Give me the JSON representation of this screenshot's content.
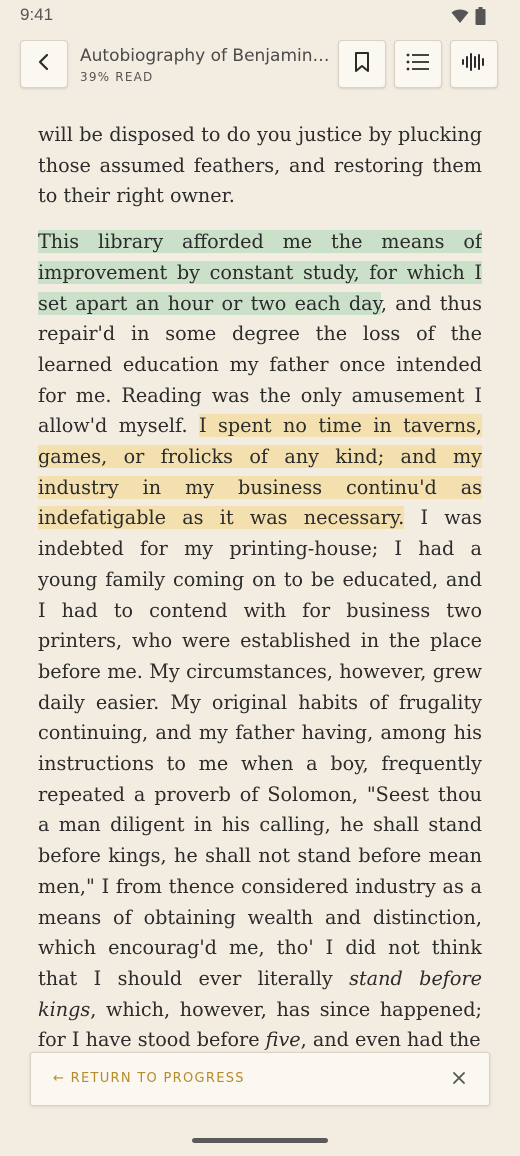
{
  "status_bar": {
    "time": "9:41",
    "icons": [
      "wifi-icon",
      "battery-icon"
    ]
  },
  "toolbar": {
    "title": "Autobiography of Benjamin Franklin",
    "progress_label": "39% READ",
    "progress": 0.39,
    "icons": {
      "back": "chevron-left-icon",
      "bookmark": "bookmark-icon",
      "contents": "list-icon",
      "audio": "audio-waveform-icon"
    }
  },
  "reader": {
    "p1": "will be disposed to do you justice by plucking those assumed feathers, and restoring them to their right owner.",
    "p2_hl_green": "This library afforded me the means of improvement by constant study, for which I set apart an hour or two each day",
    "p2_a": ", and thus repair'd in some degree the loss of the learned education my father once intended for me. Reading was the only amusement I allow'd myself. ",
    "p2_hl_yellow": "I spent no time in taverns, games, or frolicks of any kind; and my industry in my business continu'd as indefatigable as it was necessary.",
    "p2_b": " I was indebted for my printing-house; I had a young family coming on to be educated, and I had to contend with for business two printers, who were established in the place before me. My circumstances, however, grew daily easier. My original habits of frugality continuing, and my father having, among his instructions to me when a boy, frequently repeated a proverb of Solomon, \"Seest thou a man diligent in his calling, he shall stand before kings, he shall not stand before mean men,\" I from thence considered industry as a means of obtaining wealth and distinction, which encourag'd me, tho' I did not think that I should ever literally ",
    "p2_em1": "stand before kings",
    "p2_c": ", which, however, has since happened; for I have stood before ",
    "p2_em2": "five",
    "p2_d": ", and even had the"
  },
  "return_bar": {
    "label": "← RETURN TO PROGRESS",
    "close_icon": "close-icon"
  },
  "colors": {
    "background": "#f3ece0",
    "highlight_green": "#cbe0c8",
    "highlight_yellow": "#f3e0ae",
    "accent": "#b48a2c"
  }
}
